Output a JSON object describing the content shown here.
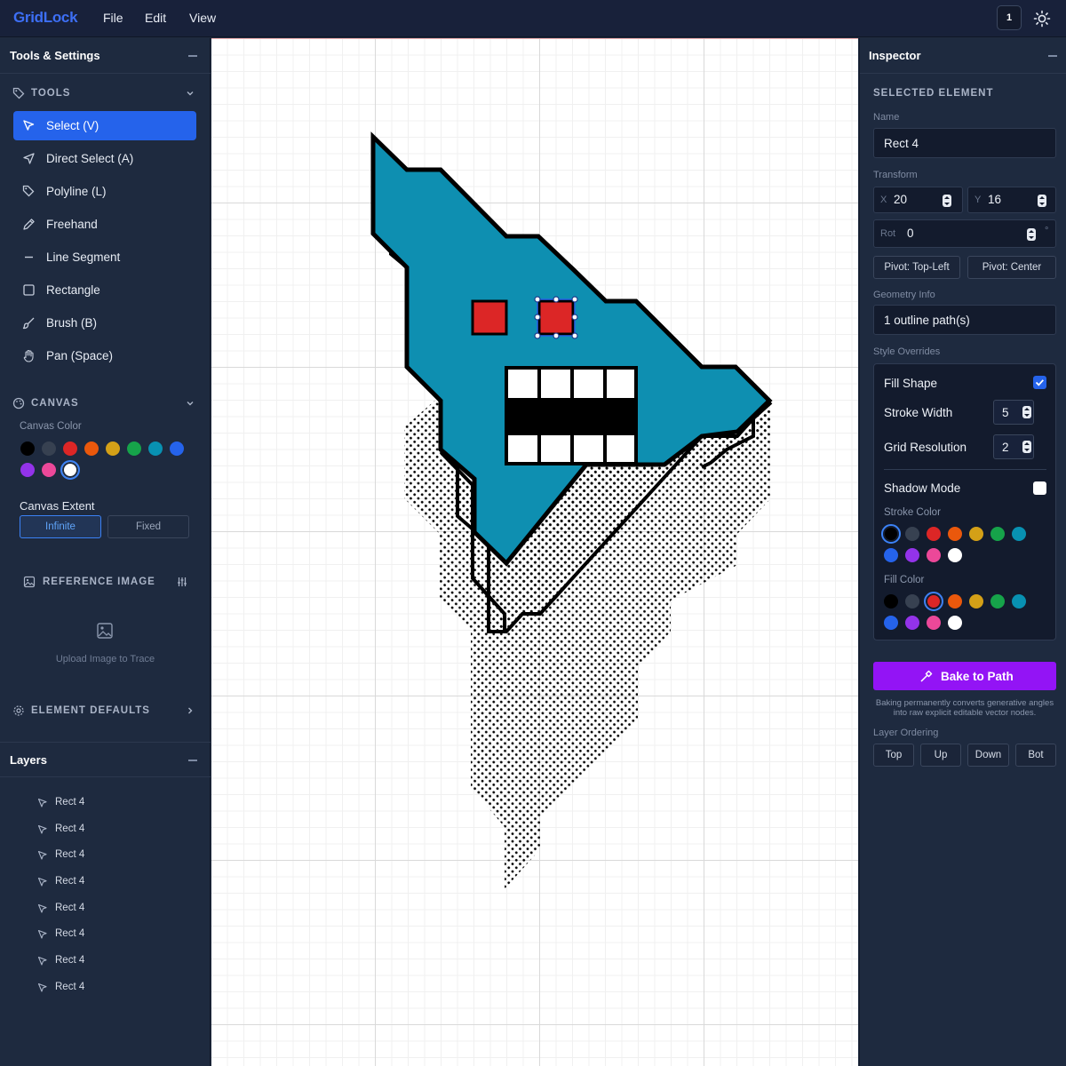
{
  "app": {
    "logo": "GridLock",
    "menu": [
      "File",
      "Edit",
      "View"
    ],
    "badge": "1",
    "theme_icon": "sun-icon"
  },
  "left_panel": {
    "title": "Tools & Settings",
    "tools_section": {
      "label": "TOOLS",
      "items": [
        {
          "label": "Select (V)",
          "icon": "cursor-icon",
          "active": true
        },
        {
          "label": "Direct Select (A)",
          "icon": "direct-select-icon"
        },
        {
          "label": "Polyline (L)",
          "icon": "polyline-icon"
        },
        {
          "label": "Freehand",
          "icon": "pencil-icon"
        },
        {
          "label": "Line Segment",
          "icon": "line-icon"
        },
        {
          "label": "Rectangle",
          "icon": "rectangle-icon"
        },
        {
          "label": "Brush (B)",
          "icon": "brush-icon"
        },
        {
          "label": "Pan (Space)",
          "icon": "hand-icon"
        }
      ]
    },
    "canvas_section": {
      "label": "CANVAS",
      "color_label": "Canvas Color",
      "colors": [
        "#000000",
        "#374151",
        "#dc2626",
        "#ea580c",
        "#d4a017",
        "#16a34a",
        "#0891b2",
        "#2563eb",
        "#9333ea",
        "#ec4899",
        "#ffffff"
      ],
      "selected_color": "#ffffff",
      "extent_label": "Canvas Extent",
      "extent_options": [
        "Infinite",
        "Fixed"
      ],
      "extent_selected": "Infinite"
    },
    "reference_section": {
      "label": "REFERENCE IMAGE",
      "upload_label": "Upload Image to Trace"
    },
    "defaults_section": {
      "label": "ELEMENT DEFAULTS"
    },
    "layers": {
      "title": "Layers",
      "items": [
        "Rect 4",
        "Rect 4",
        "Rect 4",
        "Rect 4",
        "Rect 4",
        "Rect 4",
        "Rect 4",
        "Rect 4"
      ]
    }
  },
  "inspector": {
    "title": "Inspector",
    "section": "SELECTED ELEMENT",
    "name_label": "Name",
    "name_value": "Rect 4",
    "transform_label": "Transform",
    "x_label": "X",
    "x_value": "20",
    "y_label": "Y",
    "y_value": "16",
    "rot_label": "Rot",
    "rot_value": "0",
    "rot_unit": "°",
    "pivot_buttons": [
      "Pivot: Top-Left",
      "Pivot: Center"
    ],
    "geometry_label": "Geometry Info",
    "geometry_value": "1 outline path(s)",
    "style_label": "Style Overrides",
    "fill_shape_label": "Fill Shape",
    "fill_shape": true,
    "stroke_width_label": "Stroke Width",
    "stroke_width": "5",
    "grid_res_label": "Grid Resolution",
    "grid_res": "2",
    "shadow_label": "Shadow Mode",
    "shadow": false,
    "stroke_color_label": "Stroke Color",
    "stroke_colors": [
      "#000000",
      "#374151",
      "#dc2626",
      "#ea580c",
      "#d4a017",
      "#16a34a",
      "#0891b2",
      "#2563eb",
      "#9333ea",
      "#ec4899",
      "#ffffff"
    ],
    "stroke_selected": "#000000",
    "fill_color_label": "Fill Color",
    "fill_colors": [
      "#000000",
      "#374151",
      "#dc2626",
      "#ea580c",
      "#d4a017",
      "#16a34a",
      "#0891b2",
      "#2563eb",
      "#9333ea",
      "#ec4899",
      "#ffffff"
    ],
    "fill_selected": "#dc2626",
    "bake_label": "Bake to Path",
    "bake_note": "Baking permanently converts generative angles into raw explicit editable vector nodes.",
    "ordering_label": "Layer Ordering",
    "ordering_buttons": [
      "Top",
      "Up",
      "Down",
      "Bot"
    ]
  },
  "colors": {
    "accent": "#2563eb",
    "bake": "#9314f5",
    "shape_fill": "#0e8fb1",
    "eye_fill": "#dc2626"
  }
}
